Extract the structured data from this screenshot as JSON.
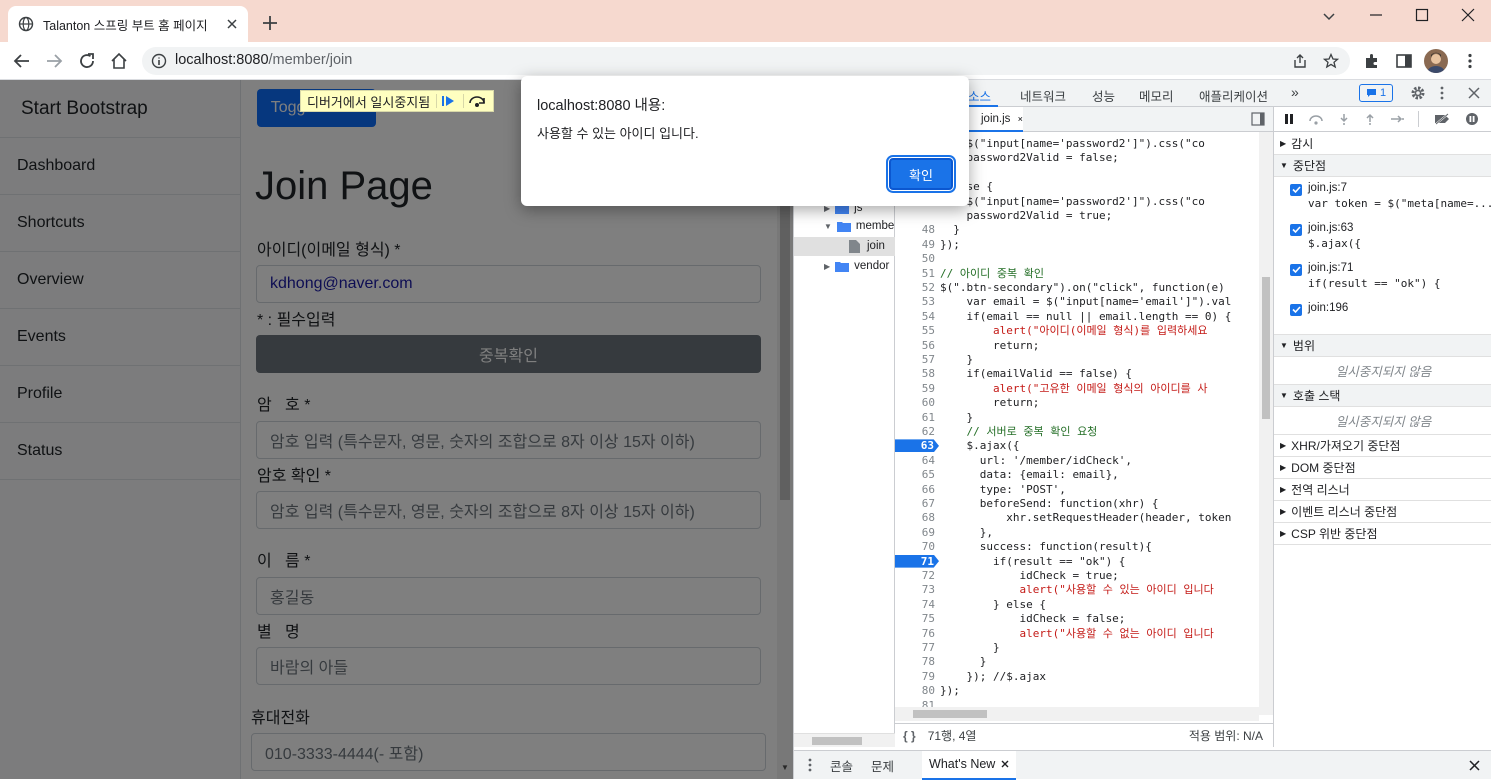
{
  "browser": {
    "tab_title": "Talanton 스프링 부트 홈 페이지",
    "url_host": "localhost:8080",
    "url_path": "/member/join"
  },
  "sidebar": {
    "brand": "Start Bootstrap",
    "items": [
      {
        "label": "Dashboard"
      },
      {
        "label": "Shortcuts"
      },
      {
        "label": "Overview"
      },
      {
        "label": "Events"
      },
      {
        "label": "Profile"
      },
      {
        "label": "Status"
      }
    ]
  },
  "main": {
    "toggle_button": "Toggle Menu",
    "page_title": "Join Page",
    "email_label": "아이디(이메일 형식) *",
    "email_value": "kdhong@naver.com",
    "required_note": "* : 필수입력",
    "check_button": "중복확인",
    "password_label": "암   호 *",
    "password_placeholder": "암호 입력 (특수문자, 영문, 숫자의 조합으로 8자 이상 15자 이하)",
    "password2_label": "암호 확인 *",
    "password2_placeholder": "암호 입력 (특수문자, 영문, 숫자의 조합으로 8자 이상 15자 이하)",
    "name_label": "이   름 *",
    "name_placeholder": "홍길동",
    "nickname_label": "별   명",
    "nickname_placeholder": "바람의 아들",
    "phone_label": "휴대전화",
    "phone_placeholder": "010-3333-4444(- 포함)"
  },
  "pause_bar": {
    "text": "디버거에서 일시중지됨"
  },
  "dialog": {
    "title": "localhost:8080 내용:",
    "message": "사용할 수 있는 아이디 입니다.",
    "ok_button": "확인"
  },
  "devtools": {
    "tabs": [
      "소스",
      "네트워크",
      "성능",
      "메모리",
      "애플리케이션"
    ],
    "more": "»",
    "issues_count": "1",
    "file_tab": "join.js",
    "file_tree": [
      {
        "label": "js",
        "type": "folder"
      },
      {
        "label": "membe",
        "type": "folder"
      },
      {
        "label": "join",
        "type": "file"
      },
      {
        "label": "vendor",
        "type": "folder"
      }
    ],
    "code_lines": [
      {
        "n": "",
        "t": "    $(\"input[name='password2']\").css(\"co"
      },
      {
        "n": "",
        "t": "    password2Valid = false;"
      },
      {
        "n": "",
        "t": "  }"
      },
      {
        "n": "",
        "t": "  else {"
      },
      {
        "n": "47",
        "t": "    $(\"input[name='password2']\").css(\"co"
      },
      {
        "n": "",
        "t": "    password2Valid = true;"
      },
      {
        "n": "48",
        "t": "  }"
      },
      {
        "n": "49",
        "t": "});"
      },
      {
        "n": "50",
        "t": ""
      },
      {
        "n": "51",
        "t": "// 아이디 중복 확인"
      },
      {
        "n": "52",
        "t": "$(\".btn-secondary\").on(\"click\", function(e)"
      },
      {
        "n": "53",
        "t": "    var email = $(\"input[name='email']\").val"
      },
      {
        "n": "54",
        "t": "    if(email == null || email.length == 0) {"
      },
      {
        "n": "55",
        "t": "        alert(\"아이디(이메일 형식)를 입력하세요"
      },
      {
        "n": "56",
        "t": "        return;"
      },
      {
        "n": "57",
        "t": "    }"
      },
      {
        "n": "58",
        "t": "    if(emailValid == false) {"
      },
      {
        "n": "59",
        "t": "        alert(\"고유한 이메일 형식의 아이디를 사"
      },
      {
        "n": "60",
        "t": "        return;"
      },
      {
        "n": "61",
        "t": "    }"
      },
      {
        "n": "62",
        "t": "    // 서버로 중복 확인 요청"
      },
      {
        "n": "63",
        "t": "    $.ajax({"
      },
      {
        "n": "64",
        "t": "      url: '/member/idCheck',"
      },
      {
        "n": "65",
        "t": "      data: {email: email},"
      },
      {
        "n": "66",
        "t": "      type: 'POST',"
      },
      {
        "n": "67",
        "t": "      beforeSend: function(xhr) {"
      },
      {
        "n": "68",
        "t": "          xhr.setRequestHeader(header, token"
      },
      {
        "n": "69",
        "t": "      },"
      },
      {
        "n": "70",
        "t": "      success: function(result){"
      },
      {
        "n": "71",
        "t": "        if(result == \"ok\") {"
      },
      {
        "n": "72",
        "t": "            idCheck = true;"
      },
      {
        "n": "73",
        "t": "            alert(\"사용할 수 있는 아이디 입니다"
      },
      {
        "n": "74",
        "t": "        } else {"
      },
      {
        "n": "75",
        "t": "            idCheck = false;"
      },
      {
        "n": "76",
        "t": "            alert(\"사용할 수 없는 아이디 입니다"
      },
      {
        "n": "77",
        "t": "        }"
      },
      {
        "n": "78",
        "t": "      }"
      },
      {
        "n": "79",
        "t": "    }); //$.ajax"
      },
      {
        "n": "80",
        "t": "});"
      },
      {
        "n": "81",
        "t": ""
      }
    ],
    "breakpoint_lines": [
      "63",
      "71"
    ],
    "status_position": "71행, 4열",
    "status_coverage": "적용 범위: N/A",
    "right_panel": {
      "watch": "감시",
      "breakpoints": "중단점",
      "bp_items": [
        {
          "file": "join.js:7",
          "code": "var token = $(\"meta[name=..."
        },
        {
          "file": "join.js:63",
          "code": "$.ajax({"
        },
        {
          "file": "join.js:71",
          "code": "if(result == \"ok\") {"
        },
        {
          "file": "join:196",
          "code": ""
        }
      ],
      "scope": "범위",
      "scope_empty": "일시중지되지 않음",
      "call_stack": "호출 스택",
      "call_stack_empty": "일시중지되지 않음",
      "xhr": "XHR/가져오기 중단점",
      "dom": "DOM 중단점",
      "global": "전역 리스너",
      "event": "이벤트 리스너 중단점",
      "csp": "CSP 위반 중단점"
    },
    "drawer_tabs": [
      "콘솔",
      "문제",
      "What's New"
    ]
  }
}
